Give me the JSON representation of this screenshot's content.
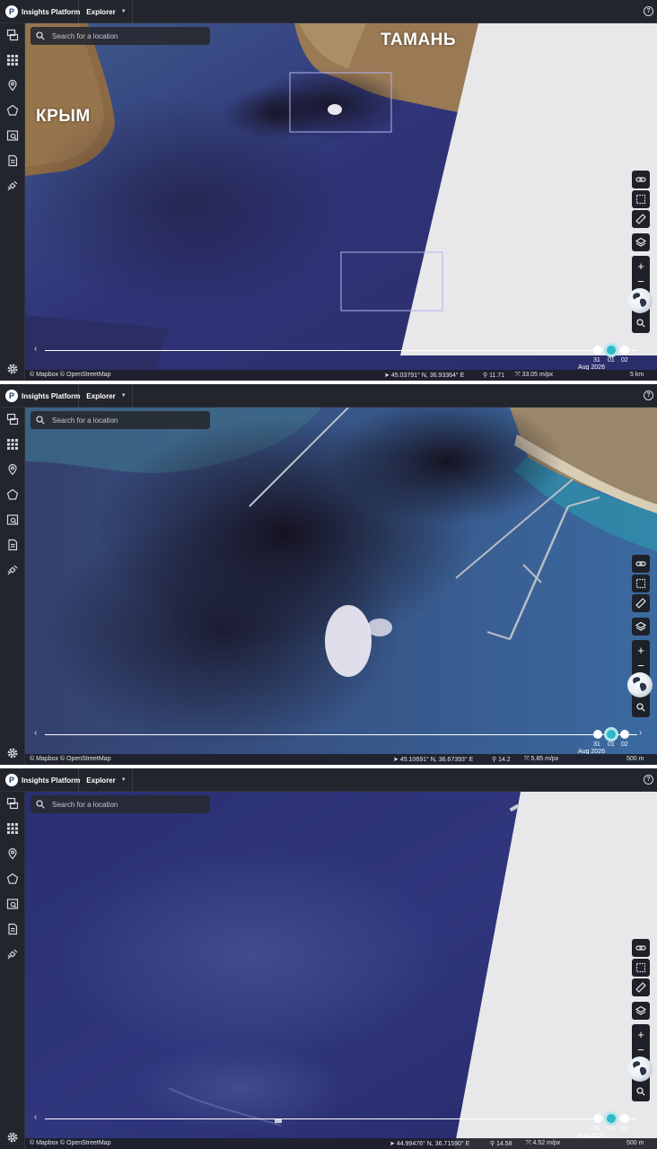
{
  "app": {
    "brand_letter": "P",
    "name": "Insights Platform",
    "menu_label": "Explorer",
    "help_label": "?"
  },
  "search": {
    "placeholder": "Search for a location"
  },
  "map_labels": {
    "crimea": "КРЫМ",
    "taman": "ТАМАНЬ"
  },
  "timeline": {
    "prev_arrow": "‹",
    "next_arrow": "›",
    "days": [
      "31",
      "01",
      "02"
    ],
    "selected_day": "01",
    "month": "Aug 2026"
  },
  "attribution": "© Mapbox © OpenStreetMap",
  "zoom_controls": {
    "zoom_in": "+",
    "zoom_out": "−"
  },
  "panels": [
    {
      "coords": "45.03791° N, 36.93364° E",
      "zoom": "11.71",
      "resolution": "33.05 m/px",
      "scale": "5 km"
    },
    {
      "coords": "45.10691° N, 36.67393° E",
      "zoom": "14.2",
      "resolution": "5.85 m/px",
      "scale": "500 m"
    },
    {
      "coords": "44.99476° N, 36.71590° E",
      "zoom": "14.58",
      "resolution": "4.52 m/px",
      "scale": "500 m"
    }
  ],
  "colors": {
    "sea": "#2e3276",
    "smoke": "#1a1530",
    "land": "#8c6a44",
    "no_data": "#e8e8ea",
    "accent": "#2fb8c8"
  }
}
